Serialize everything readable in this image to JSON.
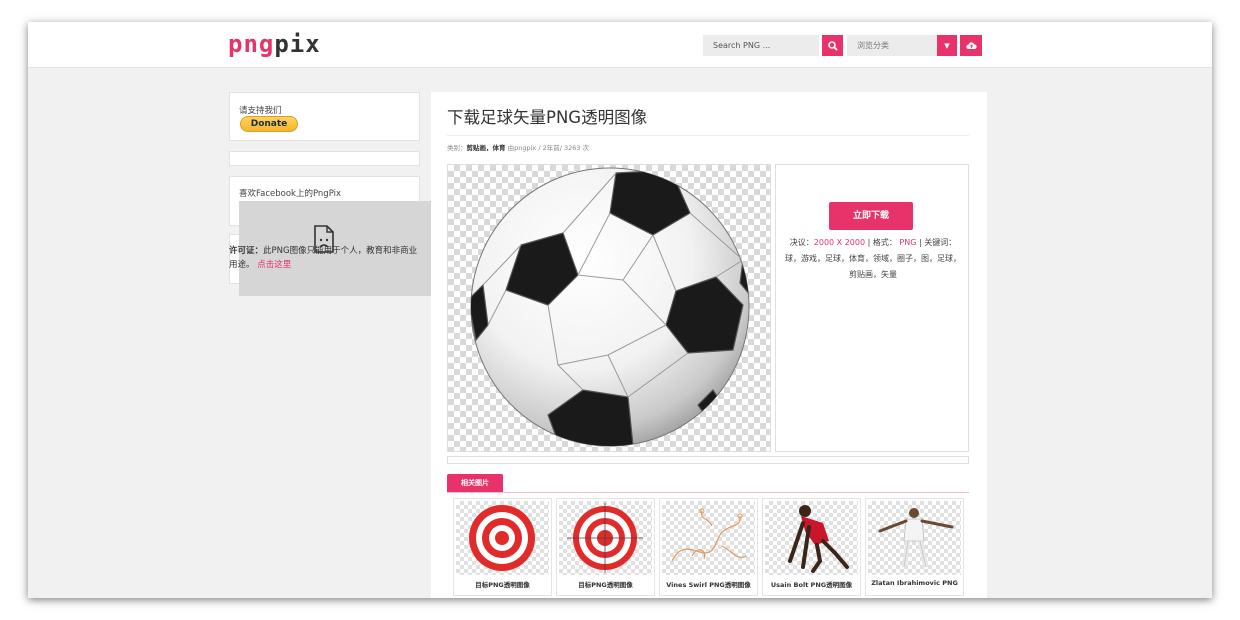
{
  "header": {
    "logo_part1": "png",
    "logo_part2": "pix",
    "search_placeholder": "Search PNG ...",
    "category_label": "浏览分类"
  },
  "sidebar": {
    "support_text": "请支持我们",
    "donate_label": "Donate",
    "facebook_text": "喜欢Facebook上的PngPix",
    "license_label": "许可证：",
    "license_text": "此PNG图像只能用于个人，教育和非商业用途。",
    "license_link": "点击这里"
  },
  "main": {
    "title": "下载足球矢量PNG透明图像",
    "meta_prefix": "类别：",
    "meta_categories": "剪贴画，体育",
    "meta_by": "由pngpix",
    "meta_rest": "/ 2年前/ 3263 次",
    "download_label": "立即下载",
    "resolution_label": "决议：",
    "resolution_value": "2000 X 2000",
    "format_label": "| 格式：",
    "format_value": "PNG",
    "keywords_label": "| 关键词：",
    "keywords": "球，游戏，足球，体育，领域，圈子，图，足球，剪贴画，矢量",
    "related_label": "相关图片"
  },
  "related": [
    {
      "caption": "目标PNG透明图像"
    },
    {
      "caption": "目标PNG透明图像"
    },
    {
      "caption": "Vines Swirl PNG透明图像"
    },
    {
      "caption": "Usain Bolt PNG透明图像"
    },
    {
      "caption": "Zlatan Ibrahimovic PNG"
    }
  ],
  "colors": {
    "accent": "#e8336a",
    "page_bg": "#f1f1f1",
    "donate_yellow": "#ffc83d"
  }
}
